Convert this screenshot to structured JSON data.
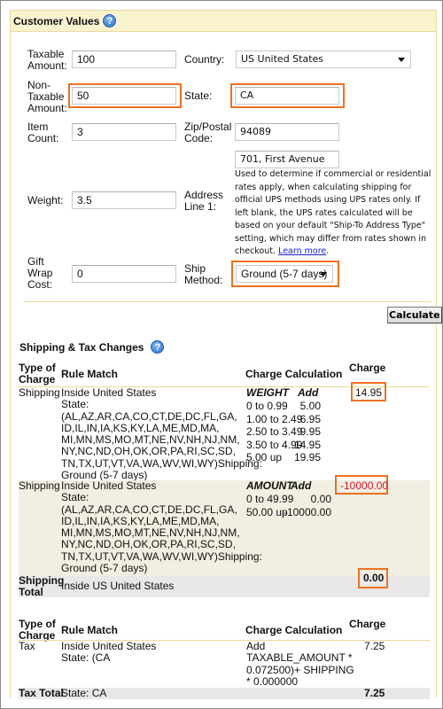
{
  "customer_values": {
    "title": "Customer Values",
    "help_icon": "question-circle-icon",
    "fields": {
      "taxable_amount": {
        "label_1": "Taxable",
        "label_2": "Amount:",
        "value": "100"
      },
      "non_taxable_amount": {
        "label_1": "Non-",
        "label_2": "Taxable",
        "label_3": "Amount:",
        "value": "50"
      },
      "item_count": {
        "label_1": "Item",
        "label_2": "Count:",
        "value": "3"
      },
      "weight": {
        "label": "Weight:",
        "value": "3.5"
      },
      "gift_wrap_cost": {
        "label_1": "Gift",
        "label_2": "Wrap",
        "label_3": "Cost:",
        "value": "0"
      },
      "country": {
        "label": "Country:",
        "value": "US United States"
      },
      "state": {
        "label": "State:",
        "value": "CA"
      },
      "zip": {
        "label_1": "Zip/Postal",
        "label_2": "Code:",
        "value": "94089"
      },
      "address_line_1": {
        "label_1": "Address",
        "label_2": "Line 1:",
        "value": "701, First Avenue"
      },
      "ship_method": {
        "label_1": "Ship",
        "label_2": "Method:",
        "value": "Ground (5-7 days)"
      }
    },
    "address_note": {
      "lines": [
        "Used to determine if commercial or residential",
        "rates apply, when calculating shipping for",
        "official UPS methods using UPS rates only. If",
        "left blank, the UPS rates calculated will be",
        "based on your default \"Ship-To Address Type\"",
        "setting, which may differ from rates shown in"
      ],
      "last_line_prefix": "checkout. ",
      "link": "Learn more",
      "last_line_suffix": "."
    },
    "calculate_button": "Calculate"
  },
  "shipping_tax_changes": {
    "title": "Shipping & Tax Changes",
    "help_icon": "question-circle-icon",
    "shipping_table": {
      "headers": {
        "type_1": "Type of",
        "type_2": "Charge",
        "rule": "Rule Match",
        "calc": "Charge Calculation",
        "charge": "Charge"
      },
      "rows": [
        {
          "type": "Shipping",
          "rule_lines": [
            "Inside United States",
            "State:",
            "(AL,AZ,AR,CA,CO,CT,DE,DC,FL,GA,",
            "ID,IL,IN,IA,KS,KY,LA,ME,MD,MA,",
            "MI,MN,MS,MO,MT,NE,NV,NH,NJ,NM,",
            "NY,NC,ND,OH,OK,OR,PA,RI,SC,SD,",
            "TN,TX,UT,VT,VA,WA,WV,WI,WY)Shipping:",
            "Ground (5-7 days)"
          ],
          "calc_header": [
            "WEIGHT",
            "Add"
          ],
          "calc_rows": [
            [
              "0 to 0.99",
              "5.00"
            ],
            [
              "1.00 to 2.49",
              "6.95"
            ],
            [
              "2.50 to 3.49",
              "9.95"
            ],
            [
              "3.50 to 4.99",
              "14.95"
            ],
            [
              "5.00 up",
              "19.95"
            ]
          ],
          "charge": "14.95"
        },
        {
          "type": "Shipping",
          "rule_lines": [
            "Inside United States",
            "State:",
            "(AL,AZ,AR,CA,CO,CT,DE,DC,FL,GA,",
            "ID,IL,IN,IA,KS,KY,LA,ME,MD,MA,",
            "MI,MN,MS,MO,MT,NE,NV,NH,NJ,NM,",
            "NY,NC,ND,OH,OK,OR,PA,RI,SC,SD,",
            "TN,TX,UT,VT,VA,WA,WV,WI,WY)Shipping:",
            "Ground (5-7 days)"
          ],
          "calc_header": [
            "AMOUNT",
            "Add"
          ],
          "calc_rows": [
            [
              "0 to 49.99",
              "0.00"
            ],
            [
              "50.00 up",
              "-10000.00"
            ]
          ],
          "charge": "-10000.00",
          "charge_color": "#e0102a"
        }
      ],
      "total": {
        "label_1": "Shipping",
        "label_2": "Total",
        "rule": "Inside US United States",
        "charge": "0.00"
      }
    },
    "tax_table": {
      "headers": {
        "type_1": "Type of",
        "type_2": "Charge",
        "rule": "Rule Match",
        "calc": "Charge Calculation",
        "charge": "Charge"
      },
      "rows": [
        {
          "type": "Tax",
          "rule_lines": [
            "Inside United States",
            "State: (CA"
          ],
          "calc_lines": [
            "Add",
            "TAXABLE_AMOUNT *",
            "0.072500)+ SHIPPING",
            "* 0.000000"
          ],
          "charge": "7.25"
        }
      ],
      "total": {
        "label": "Tax Total",
        "rule": "State: CA",
        "charge": "7.25"
      }
    }
  },
  "colors": {
    "highlight": "#f07020",
    "panel_header": "#fbf3d0",
    "panel_border": "#ecd99a",
    "negative": "#e0102a"
  }
}
